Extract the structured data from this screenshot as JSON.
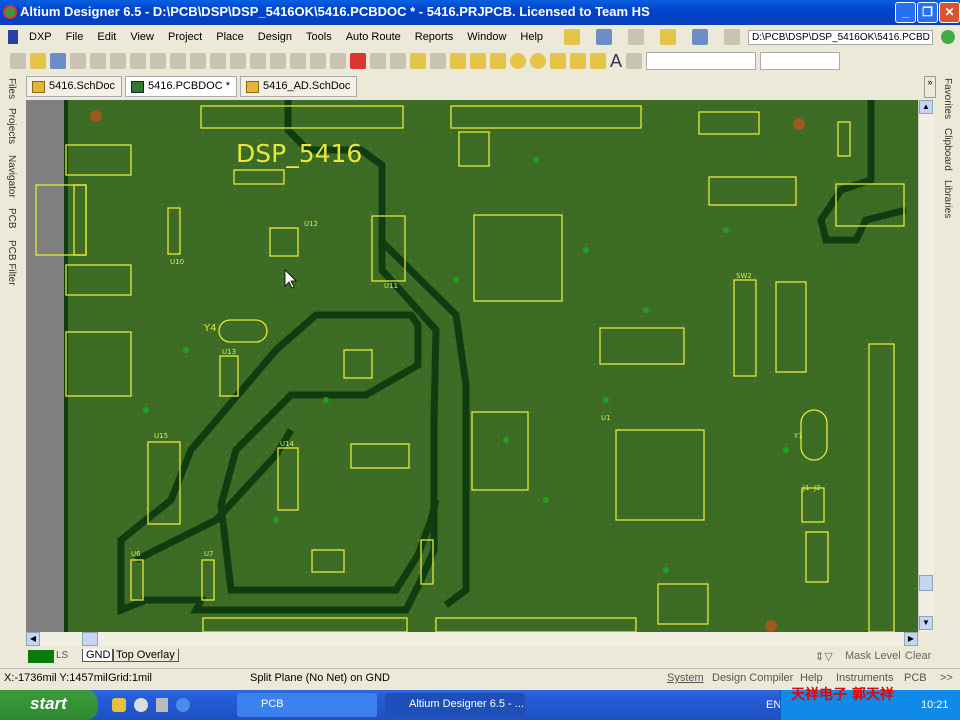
{
  "window": {
    "title": "Altium Designer 6.5 - D:\\PCB\\DSP\\DSP_5416OK\\5416.PCBDOC * - 5416.PRJPCB. Licensed to Team HS"
  },
  "menu": {
    "items": [
      "DXP",
      "File",
      "Edit",
      "View",
      "Project",
      "Place",
      "Design",
      "Tools",
      "Auto Route",
      "Reports",
      "Window",
      "Help"
    ],
    "path": "D:\\PCB\\DSP\\DSP_5416OK\\5416.PCBD"
  },
  "doc_tabs": [
    {
      "label": "5416.SchDoc"
    },
    {
      "label": "5416.PCBDOC *"
    },
    {
      "label": "5416_AD.SchDoc"
    }
  ],
  "left_panels": [
    "Files",
    "Projects",
    "Navigator",
    "PCB",
    "PCB Filter"
  ],
  "right_panels": [
    "Favorites",
    "Clipboard",
    "Libraries"
  ],
  "pcb": {
    "board_label": "DSP_5416",
    "designators": [
      "U12",
      "U11",
      "U10",
      "Y4",
      "U13",
      "U15",
      "U6",
      "U7",
      "U1",
      "Y1",
      "J1",
      "J2",
      "SW2",
      "U14"
    ],
    "colors": {
      "board": "#3c6b23",
      "overlay": "#e8e83a",
      "trace": "#0f3d10",
      "via": "#1fa01f"
    }
  },
  "layers": {
    "ls_label": "LS",
    "tabs": [
      "GND",
      "Top Overlay"
    ],
    "mask_label": "Mask Level",
    "clear_label": "Clear"
  },
  "status": {
    "coords": "X:-1736mil Y:1457mil",
    "grid": "Grid:1mil",
    "message": "Split Plane  (No Net)  on GND",
    "panels": [
      "System",
      "Design Compiler",
      "Help",
      "Instruments",
      "PCB"
    ],
    "more": ">>"
  },
  "taskbar": {
    "start": "start",
    "tasks": [
      "PCB",
      "Altium Designer 6.5 - ..."
    ],
    "lang": "EN",
    "clock": "10:21",
    "watermark": "天祥电子  郭天祥"
  }
}
